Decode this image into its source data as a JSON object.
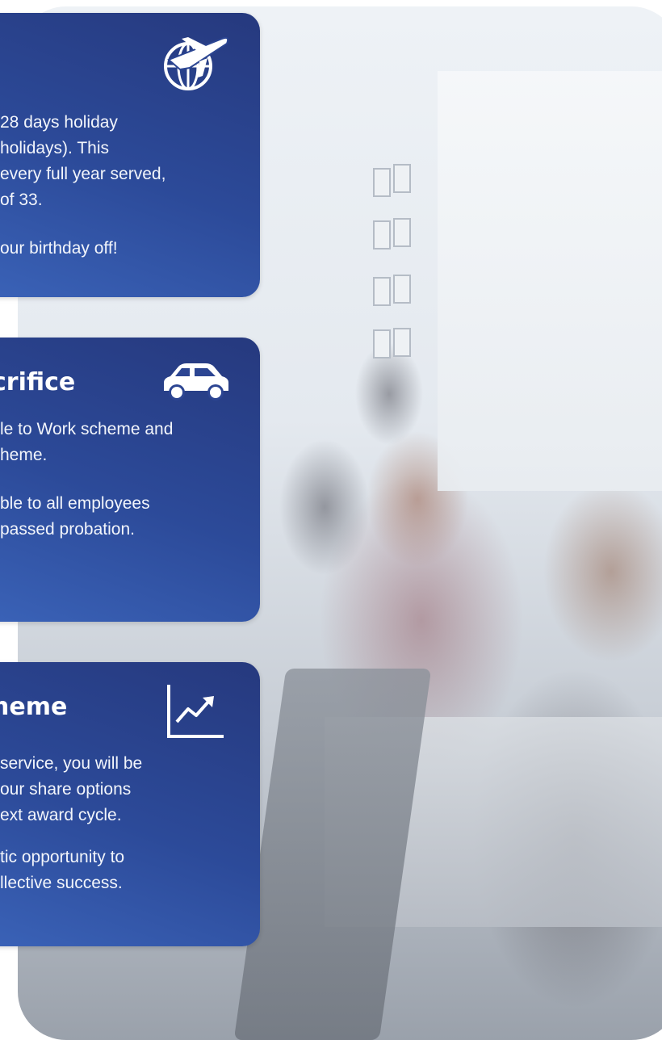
{
  "cards": [
    {
      "title": "",
      "icon": "airplane-globe-icon",
      "paragraphs": [
        [
          "28 days holiday",
          "holidays). This",
          "every full year served,",
          "of 33."
        ],
        [
          "our birthday off!"
        ]
      ]
    },
    {
      "title": "crifice",
      "icon": "car-icon",
      "paragraphs": [
        [
          "le to Work scheme and",
          "heme."
        ],
        [
          "ble to all employees",
          " passed probation."
        ]
      ]
    },
    {
      "title": "heme",
      "icon": "trending-up-chart-icon",
      "paragraphs": [
        [
          "service, you will be",
          "our share options",
          "ext award cycle."
        ],
        [
          "tic opportunity to",
          "llective success."
        ]
      ]
    }
  ],
  "colors": {
    "card_top": "#26397e",
    "card_bottom": "#3a62b7",
    "text": "#ffffff"
  }
}
